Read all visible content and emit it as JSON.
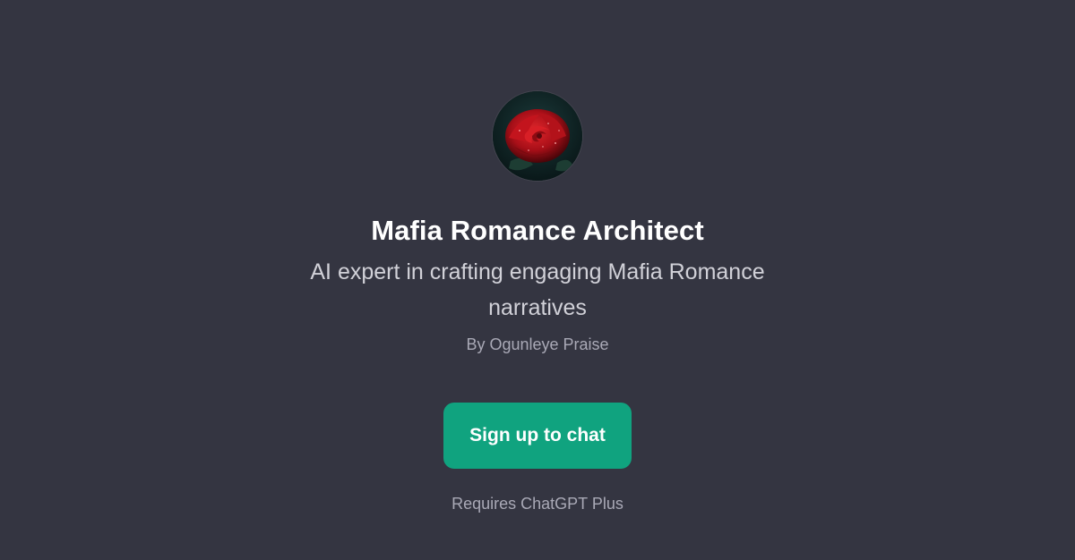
{
  "gpt": {
    "title": "Mafia Romance Architect",
    "description": "AI expert in crafting engaging Mafia Romance narratives",
    "author": "By Ogunleye Praise",
    "avatar_icon": "red-rose-icon"
  },
  "actions": {
    "signup_label": "Sign up to chat",
    "requirement_note": "Requires ChatGPT Plus"
  },
  "colors": {
    "background": "#343541",
    "accent": "#10a37f"
  }
}
